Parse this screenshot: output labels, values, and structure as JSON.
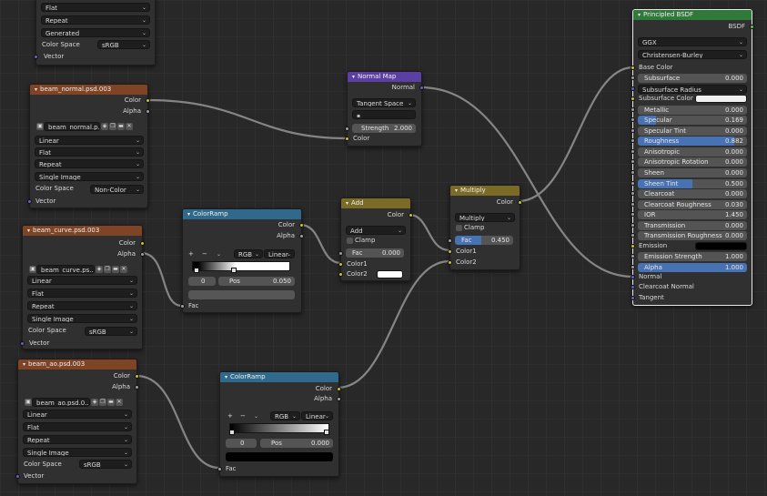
{
  "colors": {
    "tex_header": "#7e4425",
    "vector_header": "#5b3fa3",
    "converter_header": "#2f6a8c",
    "math_header": "#7a6c26",
    "shader_header": "#2f7a3a",
    "socket_color": "#c7c729",
    "socket_gray": "#a1a1a1",
    "socket_vector": "#6363c7",
    "socket_shader": "#63c763",
    "field_highlight": "#4772b3"
  },
  "top_tex": {
    "extension": "Flat",
    "repeat": "Repeat",
    "source": "Generated",
    "color_space_label": "Color Space",
    "color_space": "sRGB",
    "vector": "Vector"
  },
  "tex_normal": {
    "title": "beam_normal.psd.003",
    "out_color": "Color",
    "out_alpha": "Alpha",
    "image_name": "beam_normal.p...",
    "interpolation": "Linear",
    "projection": "Flat",
    "extension": "Repeat",
    "source": "Single Image",
    "color_space_label": "Color Space",
    "color_space": "Non-Color",
    "vector": "Vector"
  },
  "tex_curve": {
    "title": "beam_curve.psd.003",
    "out_color": "Color",
    "out_alpha": "Alpha",
    "image_name": "beam_curve.ps...",
    "interpolation": "Linear",
    "projection": "Flat",
    "extension": "Repeat",
    "source": "Single Image",
    "color_space_label": "Color Space",
    "color_space": "sRGB",
    "vector": "Vector"
  },
  "tex_ao": {
    "title": "beam_ao.psd.003",
    "out_color": "Color",
    "out_alpha": "Alpha",
    "image_name": "beam_ao.psd.0...",
    "interpolation": "Linear",
    "projection": "Flat",
    "extension": "Repeat",
    "source": "Single Image",
    "color_space_label": "Color Space",
    "color_space": "sRGB",
    "vector": "Vector"
  },
  "normal_map": {
    "title": "Normal Map",
    "out_normal": "Normal",
    "space": "Tangent Space",
    "uv_placeholder": "",
    "strength_label": "Strength",
    "strength": "2.000",
    "in_color": "Color"
  },
  "ramp1": {
    "title": "ColorRamp",
    "out_color": "Color",
    "out_alpha": "Alpha",
    "plus": "+",
    "minus": "−",
    "mode": "RGB",
    "interp": "Linear",
    "index": "0",
    "pos_label": "Pos",
    "pos": "0.050",
    "in_fac": "Fac"
  },
  "ramp2": {
    "title": "ColorRamp",
    "out_color": "Color",
    "out_alpha": "Alpha",
    "plus": "+",
    "minus": "−",
    "mode": "RGB",
    "interp": "Linear",
    "index": "0",
    "pos_label": "Pos",
    "pos": "0.000",
    "in_fac": "Fac"
  },
  "add": {
    "title": "Add",
    "out_color": "Color",
    "blend": "Add",
    "clamp": "Clamp",
    "fac_label": "Fac",
    "fac": "0.000",
    "color1": "Color1",
    "color2": "Color2"
  },
  "multiply": {
    "title": "Multiply",
    "out_color": "Color",
    "blend": "Multiply",
    "clamp": "Clamp",
    "fac_label": "Fac",
    "fac": "0.450",
    "fac_fraction": 0.45,
    "color1": "Color1",
    "color2": "Color2"
  },
  "bsdf": {
    "title": "Principled BSDF",
    "out_bsdf": "BSDF",
    "distribution": "GGX",
    "subsurface_method": "Christensen-Burley",
    "base_color": "Base Color",
    "fields": [
      {
        "label": "Subsurface",
        "value": "0.000",
        "fill": 0
      },
      {
        "label": "Subsurface Radius",
        "value": "",
        "dropdown": true
      },
      {
        "label": "Subsurface Color",
        "value": "",
        "swatch": "#f0f0f0"
      },
      {
        "label": "Metallic",
        "value": "0.000",
        "fill": 0
      },
      {
        "label": "Specular",
        "value": "0.169",
        "fill": 0.169
      },
      {
        "label": "Specular Tint",
        "value": "0.000",
        "fill": 0
      },
      {
        "label": "Roughness",
        "value": "0.882",
        "fill": 0.882
      },
      {
        "label": "Anisotropic",
        "value": "0.000",
        "fill": 0
      },
      {
        "label": "Anisotropic Rotation",
        "value": "0.000",
        "fill": 0
      },
      {
        "label": "Sheen",
        "value": "0.000",
        "fill": 0
      },
      {
        "label": "Sheen Tint",
        "value": "0.500",
        "fill": 0.5
      },
      {
        "label": "Clearcoat",
        "value": "0.000",
        "fill": 0
      },
      {
        "label": "Clearcoat Roughness",
        "value": "0.030",
        "fill": 0.03
      },
      {
        "label": "IOR",
        "value": "1.450",
        "fill": 0
      },
      {
        "label": "Transmission",
        "value": "0.000",
        "fill": 0
      },
      {
        "label": "Transmission Roughness",
        "value": "0.000",
        "fill": 0
      },
      {
        "label": "Emission",
        "value": "",
        "swatch": "#000000"
      },
      {
        "label": "Emission Strength",
        "value": "1.000",
        "fill": 0
      },
      {
        "label": "Alpha",
        "value": "1.000",
        "fill": 1
      }
    ],
    "normal": "Normal",
    "clearcoat_normal": "Clearcoat Normal",
    "tangent": "Tangent"
  }
}
